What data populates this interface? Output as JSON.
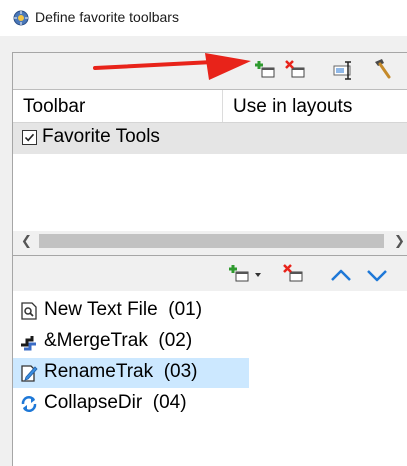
{
  "window": {
    "title": "Define favorite toolbars",
    "icon": "settings-globe-icon"
  },
  "top_toolbar": {
    "buttons": [
      {
        "name": "add-toolbar",
        "icon": "add-icon"
      },
      {
        "name": "delete-toolbar",
        "icon": "delete-icon"
      },
      {
        "name": "rename-toolbar",
        "icon": "rename-icon"
      },
      {
        "name": "configure-toolbar",
        "icon": "hammer-icon"
      }
    ]
  },
  "toolbar_grid": {
    "columns": [
      "Toolbar",
      "Use in layouts"
    ],
    "rows": [
      {
        "label": "Favorite Tools",
        "checked": true
      }
    ]
  },
  "bottom_toolbar": {
    "buttons": [
      {
        "name": "add-command",
        "icon": "add-icon",
        "has_dropdown": true
      },
      {
        "name": "remove-command",
        "icon": "delete-icon"
      },
      {
        "name": "move-up",
        "icon": "arrow-up-icon"
      },
      {
        "name": "move-down",
        "icon": "arrow-down-icon"
      }
    ]
  },
  "commands": [
    {
      "label": "New Text File",
      "number": "(01)",
      "icon": "new-text-file-icon",
      "selected": false
    },
    {
      "label": "&MergeTrak",
      "number": "(02)",
      "icon": "merge-icon",
      "selected": false
    },
    {
      "label": "RenameTrak",
      "number": "(03)",
      "icon": "rename-file-icon",
      "selected": true
    },
    {
      "label": "CollapseDir",
      "number": "(04)",
      "icon": "collapse-dir-icon",
      "selected": false
    }
  ],
  "colors": {
    "accent_red": "#e8231a",
    "add_green": "#2e9a2e",
    "arrow_blue": "#1e78d7",
    "selection": "#cce8ff"
  }
}
